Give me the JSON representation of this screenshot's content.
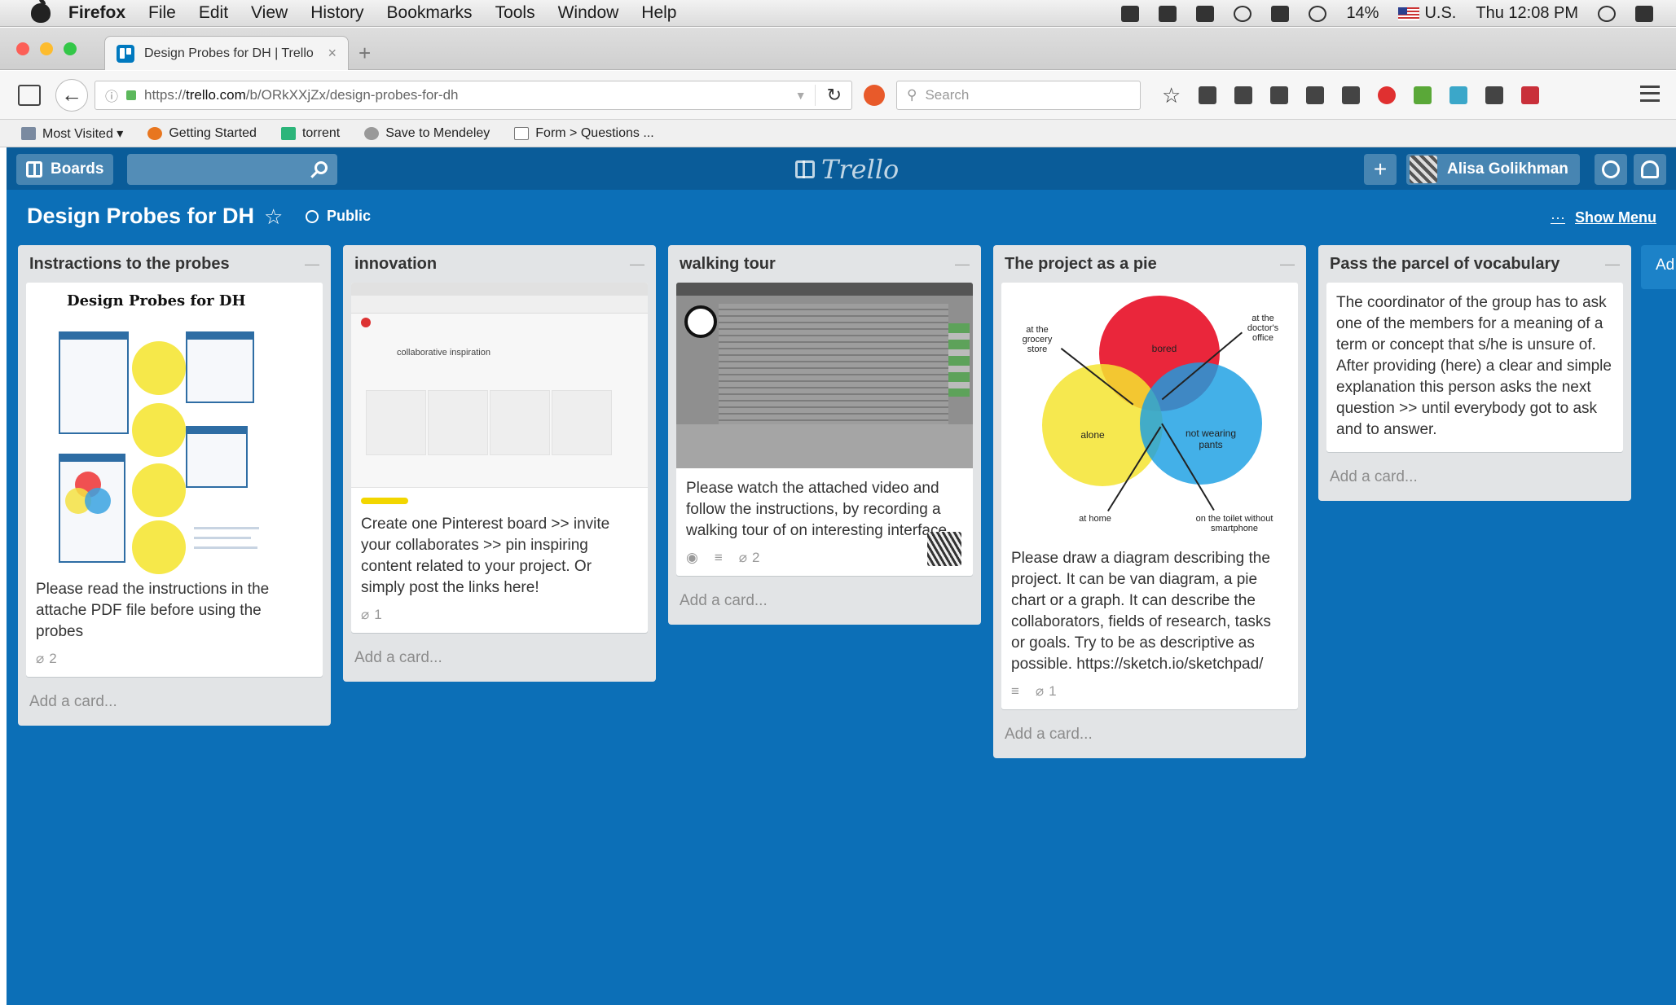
{
  "menubar": {
    "app": "Firefox",
    "items": [
      "File",
      "Edit",
      "View",
      "History",
      "Bookmarks",
      "Tools",
      "Window",
      "Help"
    ],
    "battery": "14%",
    "input_source": "U.S.",
    "clock": "Thu 12:08 PM"
  },
  "browser": {
    "tab_title": "Design Probes for DH | Trello",
    "tab_close": "×",
    "new_tab": "+",
    "url_prefix": "https://",
    "url_domain": "trello.com",
    "url_path": "/b/ORkXXjZx/design-probes-for-dh",
    "search_placeholder": "Search",
    "bookmarks": [
      "Most Visited ▾",
      "Getting Started",
      "torrent",
      "Save to Mendeley",
      "Form > Questions ..."
    ]
  },
  "trello": {
    "boards_label": "Boards",
    "logo_text": "Trello",
    "add_label": "+",
    "user_name": "Alisa Golikhman",
    "board_title": "Design Probes for DH",
    "star": "☆",
    "visibility": "Public",
    "show_menu": "Show Menu",
    "show_menu_dots": "···",
    "next_list_peek": "Ad"
  },
  "lists": [
    {
      "title": "Instractions to the probes",
      "pdf_title": "Design Probes for DH",
      "card_text": "Please read the instructions in the attache PDF file before using the probes",
      "attachments": "2",
      "add_card": "Add a card..."
    },
    {
      "title": "innovation",
      "inner_title": "collaborative inspiration",
      "card_text": "Create one Pinterest board >> invite your collaborates >> pin inspiring content related to your project. Or simply post the links here!",
      "attachments": "1",
      "add_card": "Add a card..."
    },
    {
      "title": "walking tour",
      "card_text": "Please watch the attached video and follow the instructions, by recording a walking tour of on interesting interface.",
      "attachments": "2",
      "add_card": "Add a card..."
    },
    {
      "title": "The project as a pie",
      "venn": {
        "grocery": "at the grocery store",
        "doctor": "at the doctor's office",
        "home": "at home",
        "toilet": "on the toilet without smartphone",
        "bored": "bored",
        "alone": "alone",
        "not_wearing": "not wearing pants"
      },
      "card_text": "Please draw a diagram describing the project. It can be van diagram, a pie chart or a graph. It can describe the collaborators, fields of research, tasks or goals. Try to be as descriptive as possible. https://sketch.io/sketchpad/",
      "attachments": "1",
      "add_card": "Add a card..."
    },
    {
      "title": "Pass the parcel of vocabulary",
      "card_text": "The coordinator of the group has to ask one of the members for a meaning of a term or concept that s/he is unsure of. After providing (here) a clear and simple explanation this person asks the next question >> until everybody got to ask and to answer.",
      "add_card": "Add a card..."
    }
  ],
  "colors": {
    "board_bg": "#0c6fb7",
    "header_bg": "#0a5c99",
    "list_bg": "#e2e4e6",
    "label_yellow": "#f2d600"
  }
}
